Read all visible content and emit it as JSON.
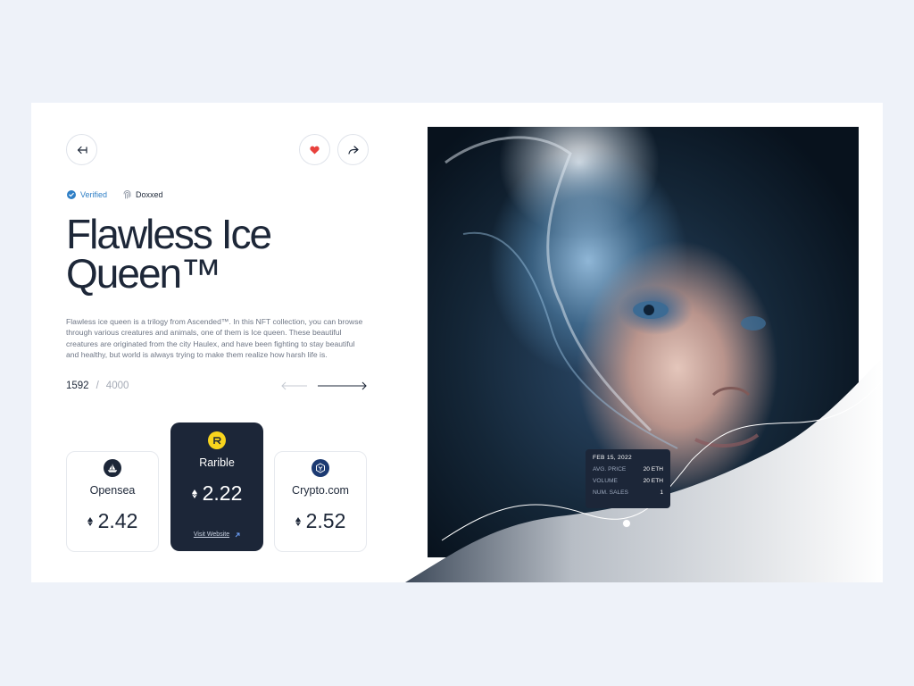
{
  "title": "Flawless Ice Queen™",
  "badges": {
    "verified": "Verified",
    "doxxed": "Doxxed"
  },
  "description": "Flawless ice queen is a trilogy from Ascended™. In this NFT collection, you can browse through various creatures and animals, one of them is Ice queen. These beautiful creatures are originated from the city Haulex, and have been fighting to stay beautiful and healthy, but world is always trying to make them realize how harsh life is.",
  "counter": {
    "current": "1592",
    "separator": "/",
    "total": "4000"
  },
  "markets": [
    {
      "name": "Opensea",
      "value": "2.42"
    },
    {
      "name": "Rarible",
      "value": "2.22",
      "link": "Visit Website",
      "active": true
    },
    {
      "name": "Crypto.com",
      "value": "2.52"
    }
  ],
  "tooltip": {
    "date": "FEB 15, 2022",
    "rows": [
      {
        "label": "AVG. PRICE",
        "value": "20 ETH"
      },
      {
        "label": "VOLUME",
        "value": "20 ETH"
      },
      {
        "label": "NUM. SALES",
        "value": "1"
      }
    ]
  },
  "colors": {
    "accent_dark": "#1c2638",
    "verified_blue": "#2f7fc6",
    "heart_red": "#e8413c",
    "rarible_yellow": "#f8d41d"
  },
  "icons": {
    "back": "back-arrow-icon",
    "like": "heart-icon",
    "share": "share-icon",
    "verified": "check-badge-icon",
    "doxxed": "fingerprint-icon",
    "opensea": "opensea-logo-icon",
    "rarible": "rarible-logo-icon",
    "crypto": "crypto-com-logo-icon",
    "eth": "eth-icon"
  }
}
